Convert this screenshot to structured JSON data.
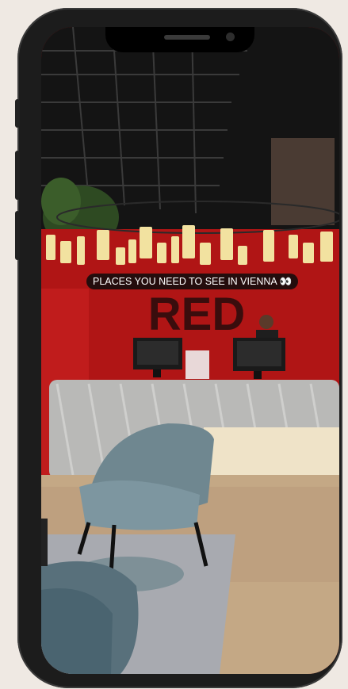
{
  "story": {
    "caption": "PLACES YOU NEED TO SEE IN VIENNA 👀"
  },
  "sign": {
    "text": "RED"
  }
}
